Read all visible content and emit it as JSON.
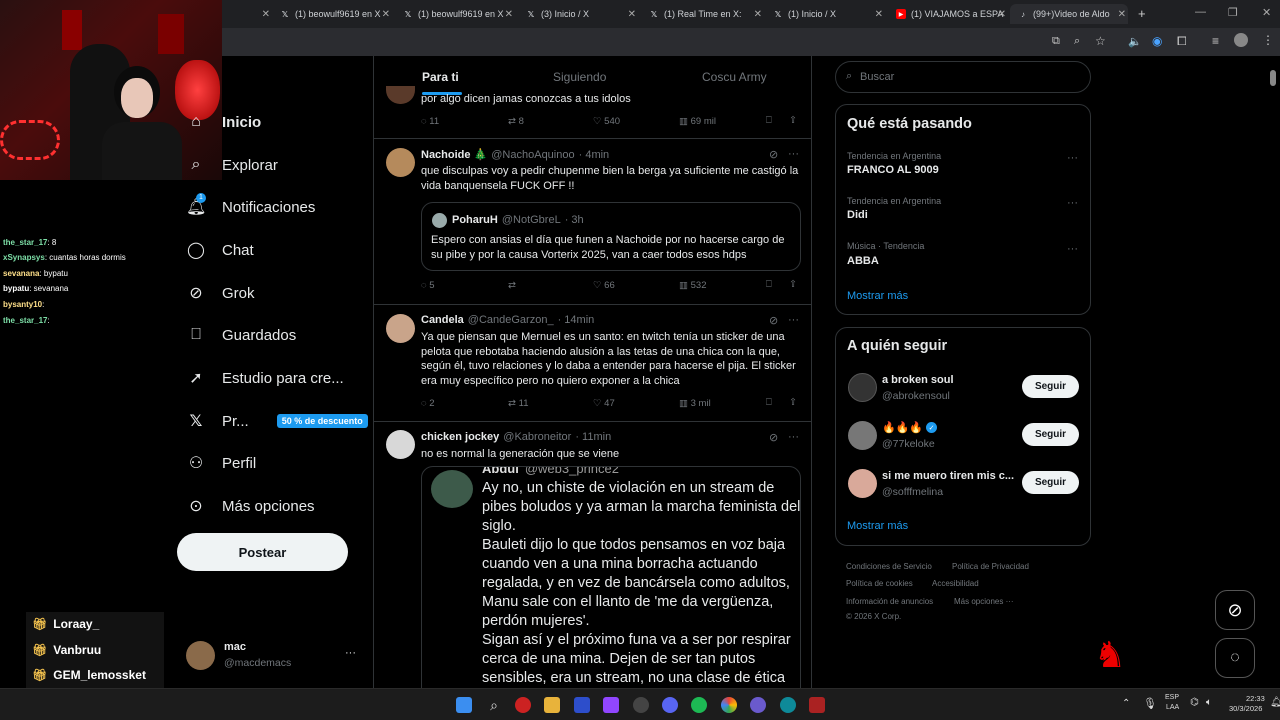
{
  "browser": {
    "tabs": [
      {
        "label": "(1) beowulf9619 en X",
        "icon": "x-icon"
      },
      {
        "label": "(1) beowulf9619 en X",
        "icon": "x-icon"
      },
      {
        "label": "(3) Inicio / X",
        "icon": "x-icon"
      },
      {
        "label": "(1) Real Time en X:",
        "icon": "x-icon"
      },
      {
        "label": "(1) Inicio / X",
        "icon": "x-icon"
      },
      {
        "label": "(1) VIAJAMOS a ESPA",
        "icon": "youtube-icon"
      },
      {
        "label": "(99+)Video de Aldo",
        "icon": "tiktok-icon"
      }
    ],
    "new_tab": "+"
  },
  "nav": {
    "items": [
      {
        "label": "Inicio",
        "icon": "home-icon"
      },
      {
        "label": "Explorar",
        "icon": "search-icon"
      },
      {
        "label": "Notificaciones",
        "icon": "bell-icon",
        "badge": "1"
      },
      {
        "label": "Chat",
        "icon": "chat-icon"
      },
      {
        "label": "Grok",
        "icon": "grok-icon"
      },
      {
        "label": "Guardados",
        "icon": "bookmark-icon"
      },
      {
        "label": "Estudio para cre...",
        "icon": "rocket-icon"
      },
      {
        "label": "Pr...",
        "icon": "x-logo-icon",
        "badge": "50 % de descuento"
      },
      {
        "label": "Perfil",
        "icon": "user-icon"
      },
      {
        "label": "Más opciones",
        "icon": "more-circle-icon"
      }
    ],
    "post_button": "Postear",
    "account": {
      "name": "mac",
      "handle": "@macdemacs",
      "more": "···"
    }
  },
  "feed": {
    "tabs": [
      "Para ti",
      "Siguiendo",
      "Coscu Army"
    ],
    "active_tab": "Para ti",
    "tweets": [
      {
        "text": "por algo dicen jamas conozcas a tus idolos",
        "replies": "11",
        "reposts": "8",
        "likes": "540",
        "views": "69 mil"
      },
      {
        "name": "Nachoide 🎄",
        "handle": "@NachoAquinoo",
        "time": "· 4min",
        "text": "que disculpas voy a pedir chupenme bien la berga ya suficiente me castigó la vida banquensela FUCK OFF !!",
        "quote": {
          "name": "PoharuH",
          "handle": "@NotGbreL",
          "time": "· 3h",
          "text": "Espero con ansias el día que funen a Nachoide por no hacerse cargo de su pibe y por la causa Vorterix 2025, van a caer todos esos hdps"
        },
        "replies": "5",
        "reposts": "",
        "likes": "66",
        "views": "532"
      },
      {
        "name": "Candela",
        "handle": "@CandeGarzon_",
        "time": "· 14min",
        "text": "Ya que piensan que Mernuel es un santo: en twitch tenía un sticker de una pelota que rebotaba haciendo alusión a las tetas de una chica con la que, según él, tuvo relaciones y lo daba a entender para hacerse el pija. El sticker era muy específico pero no quiero exponer a la chica",
        "replies": "2",
        "reposts": "11",
        "likes": "47",
        "views": "3 mil"
      },
      {
        "name": "chicken jockey",
        "handle": "@Kabroneitor",
        "time": "· 11min",
        "text": "no es normal la generación que se viene",
        "quote": {
          "name": "Abdul",
          "handle": "@web3_prince2",
          "text": "Ay no, un chiste de violación en un stream de pibes boludos y ya arman la marcha feminista del siglo.\nBauleti dijo lo que todos pensamos en voz baja cuando ven a una mina borracha actuando regalada, y en vez de bancársela como adultos, Manu sale con el llanto de 'me da vergüenza, perdón mujeres'.\nSigan así y el próximo funa va a ser por respirar cerca de una mina. Dejen de ser tan putos sensibles, era un stream, no una clase de ética"
        }
      }
    ]
  },
  "sidebar": {
    "search_placeholder": "Buscar",
    "trends_title": "Qué está pasando",
    "trends": [
      {
        "meta": "Tendencia en Argentina",
        "name": "FRANCO AL 9009"
      },
      {
        "meta": "Tendencia en Argentina",
        "name": "Didi"
      },
      {
        "meta": "Música · Tendencia",
        "name": "ABBA"
      }
    ],
    "show_more": "Mostrar más",
    "follow_title": "A quién seguir",
    "follow": [
      {
        "name": "a broken soul",
        "handle": "@abrokensoul",
        "button": "Seguir"
      },
      {
        "name": "🔥🔥🔥",
        "handle": "@77keloke",
        "button": "Seguir"
      },
      {
        "name": "si me muero tiren mis c...",
        "handle": "@sofffmelina",
        "button": "Seguir"
      }
    ],
    "follow_more": "Mostrar más",
    "footer": [
      "Condiciones de Servicio",
      "Política de Privacidad",
      "Política de cookies",
      "Accesibilidad",
      "Información de anuncios",
      "Más opciones ···",
      "© 2026 X Corp."
    ]
  },
  "stream_chat": {
    "lines": [
      {
        "user": "the_star_17",
        "msg": ": 8",
        "color": "#7ee0a8"
      },
      {
        "user": "xSynapsys",
        "msg": ": cuantas horas dormis",
        "color": "#7ee0a8"
      },
      {
        "user": "sevanana",
        "msg": ": bypatu",
        "color": "#ffe08a"
      },
      {
        "user": "bypatu",
        "msg": ": sevanana",
        "color": "#ffffff"
      },
      {
        "user": "bysanty10",
        "msg": ":",
        "color": "#ffe08a"
      },
      {
        "user": "the_star_17",
        "msg": ":",
        "color": "#7ee0a8"
      }
    ],
    "gifts": [
      "Loraay_",
      "Vanbruu",
      "GEM_lemossket"
    ]
  },
  "taskbar": {
    "lang": "ESP",
    "lang2": "LAA",
    "time": "22:33",
    "date": "30/3/2026"
  },
  "colors": {
    "accent": "#1d9bf0",
    "bg": "#000000",
    "border": "#2f3336",
    "muted": "#71767b"
  }
}
